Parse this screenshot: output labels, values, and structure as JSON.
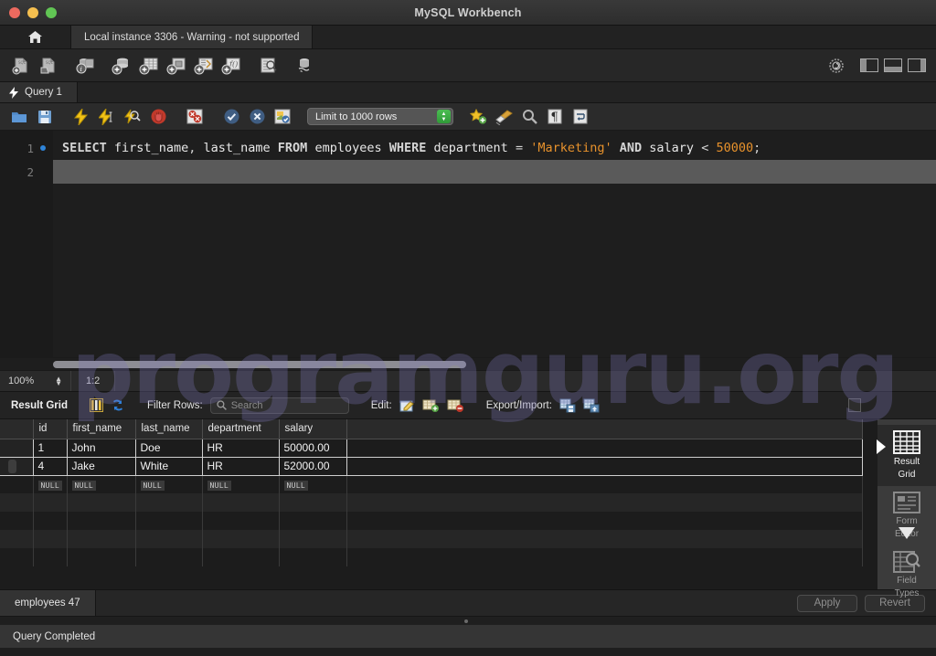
{
  "window": {
    "title": "MySQL Workbench",
    "traffic_lights": [
      "close",
      "minimize",
      "zoom"
    ]
  },
  "instance_bar": {
    "home_icon": "home-icon",
    "tab_label": "Local instance 3306 - Warning - not supported"
  },
  "main_toolbar": {
    "icons": [
      {
        "name": "new-sql-file-icon",
        "title": "Create a new SQL tab"
      },
      {
        "name": "open-sql-file-icon",
        "title": "Open a SQL script file"
      },
      {
        "name": "connection-info-icon",
        "title": "Connection info"
      },
      {
        "name": "new-schema-icon",
        "title": "Create a new schema"
      },
      {
        "name": "new-table-icon",
        "title": "Create a new table"
      },
      {
        "name": "new-view-icon",
        "title": "Create a new view"
      },
      {
        "name": "new-procedure-icon",
        "title": "Create a new procedure"
      },
      {
        "name": "new-function-icon",
        "title": "Create a new function"
      },
      {
        "name": "search-table-data-icon",
        "title": "Search table data"
      },
      {
        "name": "reconnect-dbms-icon",
        "title": "Reconnect to DBMS"
      }
    ],
    "right_icons": [
      {
        "name": "admin-gear-icon"
      },
      {
        "name": "toggle-sidebar-icon"
      },
      {
        "name": "toggle-output-icon"
      },
      {
        "name": "toggle-secondary-sidebar-icon"
      }
    ]
  },
  "query_tab": {
    "label": "Query 1",
    "icon": "lightning-bolt-icon"
  },
  "editor_toolbar": {
    "icons": [
      {
        "name": "open-script-icon"
      },
      {
        "name": "save-script-icon"
      },
      {
        "name": "execute-statement-icon"
      },
      {
        "name": "execute-current-statement-icon"
      },
      {
        "name": "explain-query-icon"
      },
      {
        "name": "stop-execution-icon"
      },
      {
        "name": "toggle-stop-on-error-icon"
      },
      {
        "name": "commit-transaction-icon"
      },
      {
        "name": "rollback-transaction-icon"
      },
      {
        "name": "toggle-autocommit-icon"
      }
    ],
    "limit_rows": {
      "value": "Limit to 1000 rows",
      "control": "row-limit-select"
    },
    "right_icons": [
      {
        "name": "beautify-sql-icon"
      },
      {
        "name": "clear-sql-icon"
      },
      {
        "name": "find-icon"
      },
      {
        "name": "toggle-invisible-chars-icon"
      },
      {
        "name": "wrap-lines-icon"
      }
    ]
  },
  "editor": {
    "lines": [
      {
        "number": "1",
        "has_breakpoint_dot": true
      },
      {
        "number": "2",
        "has_breakpoint_dot": false
      }
    ],
    "sql_full": "SELECT first_name, last_name FROM employees WHERE department = 'Marketing' AND salary < 50000;",
    "tokens": {
      "select": "SELECT",
      "first_name": "first_name",
      "comma": ",",
      "last_name": "last_name",
      "from": "FROM",
      "employees": "employees",
      "where": "WHERE",
      "department": "department",
      "eq": "=",
      "marketing": "'Marketing'",
      "and": "AND",
      "salary": "salary",
      "lt": "<",
      "fifty_thousand": "50000",
      "semicolon": ";"
    },
    "colors": {
      "string_literal": "#e8922c",
      "number_literal": "#e8922c",
      "keyword": "#d4d4d4"
    }
  },
  "watermark": {
    "text": "programguru.org",
    "color": "#7e76ba"
  },
  "editor_status": {
    "zoom": "100%",
    "caret_position": "1:2"
  },
  "result_grid_toolbar": {
    "title": "Result Grid",
    "grid_view_icon": "grid-columns-icon",
    "refresh_icon": "refresh-icon",
    "filter_label": "Filter Rows:",
    "search_placeholder": "Search",
    "search_value": "",
    "edit_label": "Edit:",
    "edit_icons": [
      {
        "name": "edit-row-icon"
      },
      {
        "name": "insert-row-icon"
      },
      {
        "name": "delete-row-icon"
      }
    ],
    "export_label": "Export/Import:",
    "export_icons": [
      {
        "name": "export-recordset-icon"
      },
      {
        "name": "import-recordset-icon"
      }
    ],
    "wrap_cell_icon": "wrap-cell-content-icon"
  },
  "results": {
    "columns": [
      "id",
      "first_name",
      "last_name",
      "department",
      "salary"
    ],
    "rows": [
      {
        "id": "1",
        "first_name": "John",
        "last_name": "Doe",
        "department": "HR",
        "salary": "50000.00"
      },
      {
        "id": "4",
        "first_name": "Jake",
        "last_name": "White",
        "department": "HR",
        "salary": "52000.00"
      }
    ],
    "null_placeholder": "NULL",
    "empty_row_count": 4
  },
  "view_switcher": {
    "items": [
      {
        "label_line1": "Result",
        "label_line2": "Grid",
        "icon": "result-grid-icon",
        "active": true
      },
      {
        "label_line1": "Form",
        "label_line2": "Editor",
        "icon": "form-editor-icon",
        "active": false
      },
      {
        "label_line1": "Field",
        "label_line2": "Types",
        "icon": "field-types-icon",
        "active": false
      }
    ],
    "more_icon": "chevron-down-icon"
  },
  "bottom": {
    "tab_label": "employees 47",
    "apply_label": "Apply",
    "revert_label": "Revert"
  },
  "statusbar": {
    "message": "Query Completed"
  }
}
